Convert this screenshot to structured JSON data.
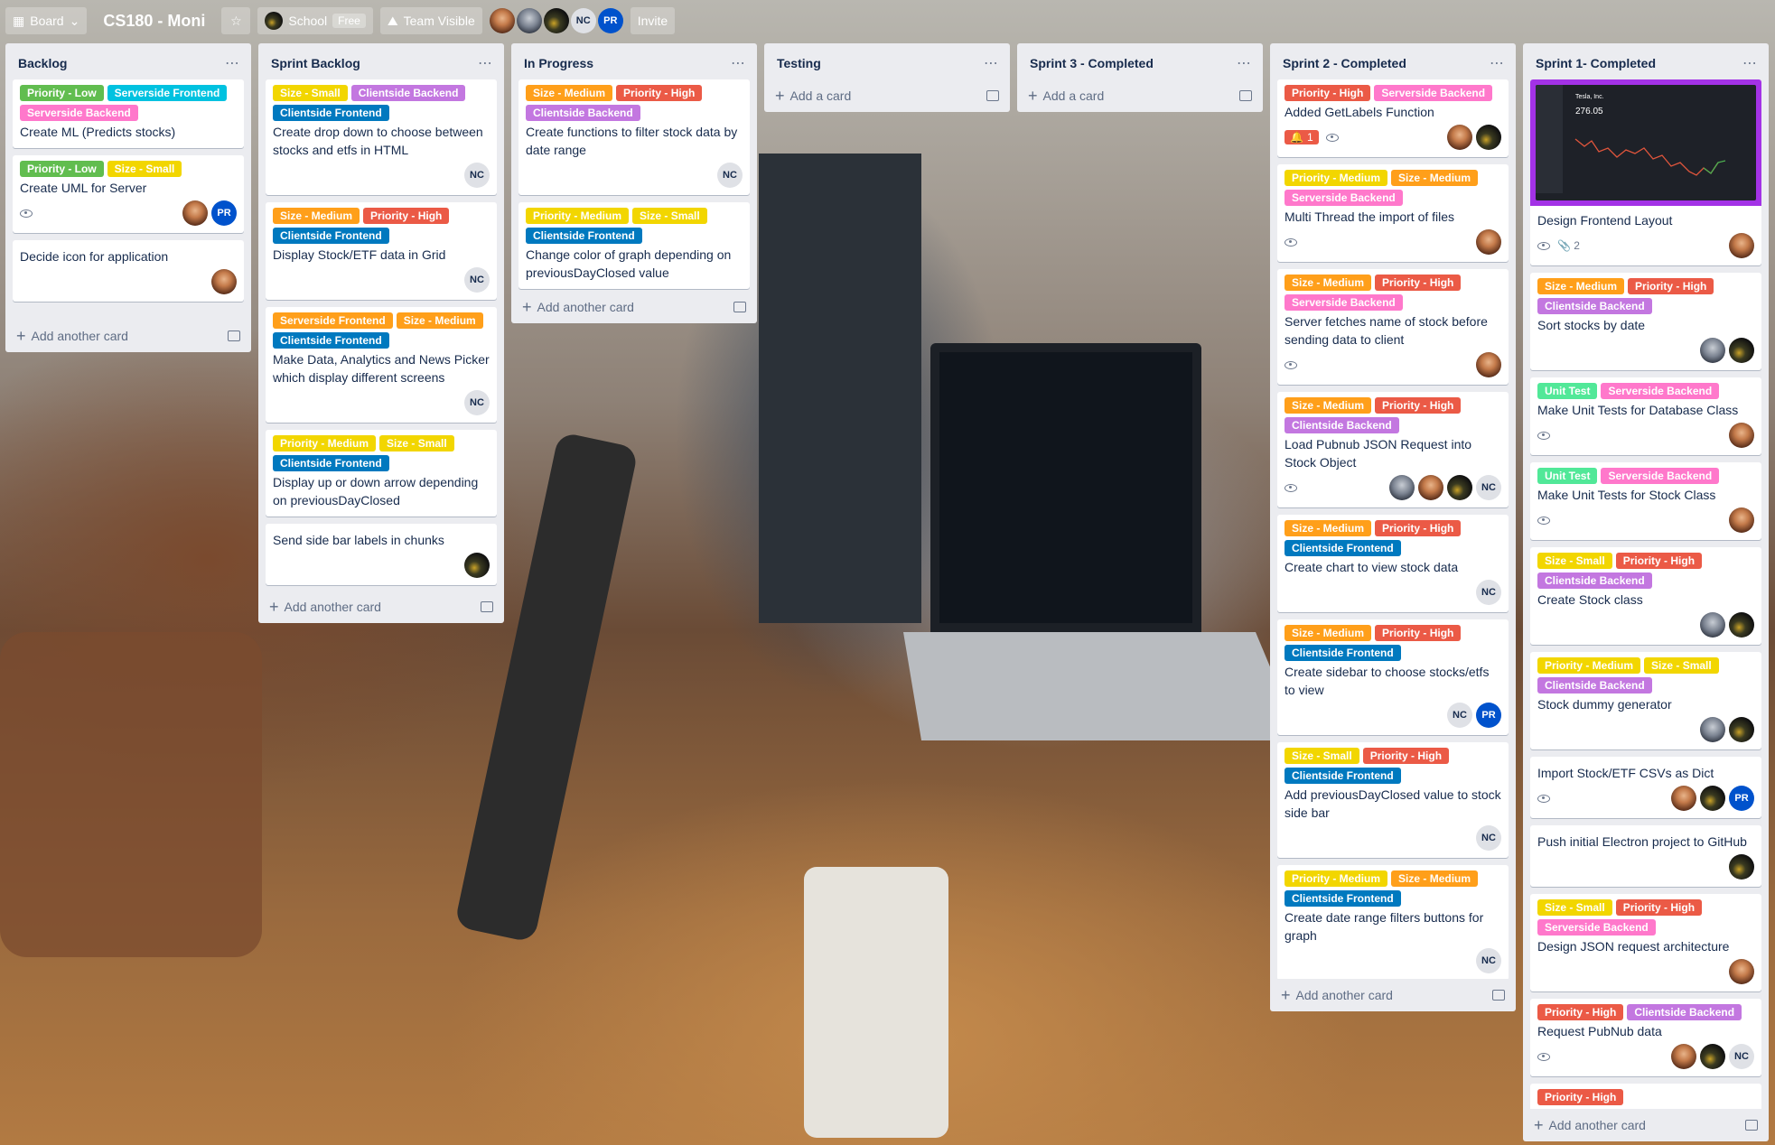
{
  "header": {
    "board_switch": "Board",
    "title": "CS180 - Moni",
    "team_name": "School",
    "team_plan": "Free",
    "visibility": "Team Visible",
    "members": [
      "NC",
      "PR"
    ],
    "invite": "Invite"
  },
  "colors": {
    "green": "#61bd4f",
    "sky": "#00c2e0",
    "pink": "#ff78cb",
    "yellow": "#f2d600",
    "purple": "#c377e0",
    "blue": "#0079bf",
    "orange": "#ff9f1a",
    "red": "#eb5a46",
    "lime": "#51e898"
  },
  "lists": [
    {
      "title": "Backlog",
      "add": "Add another card",
      "cards": [
        {
          "labels": [
            [
              "Priority - Low",
              "green"
            ],
            [
              "Serverside Frontend",
              "sky"
            ],
            [
              "Serverside Backend",
              "pink"
            ]
          ],
          "title": "Create ML (Predicts stocks)"
        },
        {
          "labels": [
            [
              "Priority - Low",
              "green"
            ],
            [
              "Size - Small",
              "yellow"
            ]
          ],
          "title": "Create UML for Server",
          "watch": true,
          "members": [
            "photo1",
            "PR"
          ]
        },
        {
          "labels": [],
          "title": "Decide icon for application",
          "members": [
            "photo1"
          ]
        }
      ]
    },
    {
      "title": "Sprint Backlog",
      "add": "Add another card",
      "cards": [
        {
          "labels": [
            [
              "Size - Small",
              "yellow"
            ],
            [
              "Clientside Backend",
              "purple"
            ],
            [
              "Clientside Frontend",
              "blue"
            ]
          ],
          "title": "Create drop down to choose between stocks and etfs in HTML",
          "members": [
            "NC"
          ]
        },
        {
          "labels": [
            [
              "Size - Medium",
              "orange"
            ],
            [
              "Priority - High",
              "red"
            ],
            [
              "Clientside Frontend",
              "blue"
            ]
          ],
          "title": "Display Stock/ETF data in Grid",
          "members": [
            "NC"
          ]
        },
        {
          "labels": [
            [
              "Serverside Frontend",
              "orange"
            ],
            [
              "Size - Medium",
              "orange"
            ],
            [
              "Clientside Frontend",
              "blue"
            ]
          ],
          "title": "Make Data, Analytics and News Picker which display different screens",
          "members": [
            "NC"
          ]
        },
        {
          "labels": [
            [
              "Priority - Medium",
              "yellow"
            ],
            [
              "Size - Small",
              "yellow"
            ],
            [
              "Clientside Frontend",
              "blue"
            ]
          ],
          "title": "Display up or down arrow depending on previousDayClosed"
        },
        {
          "labels": [],
          "title": "Send side bar labels in chunks",
          "members": [
            "dark"
          ]
        }
      ]
    },
    {
      "title": "In Progress",
      "add": "Add another card",
      "cards": [
        {
          "labels": [
            [
              "Size - Medium",
              "orange"
            ],
            [
              "Priority - High",
              "red"
            ],
            [
              "Clientside Backend",
              "purple"
            ]
          ],
          "title": "Create functions to filter stock data by date range",
          "members": [
            "NC"
          ]
        },
        {
          "labels": [
            [
              "Priority - Medium",
              "yellow"
            ],
            [
              "Size - Small",
              "yellow"
            ],
            [
              "Clientside Frontend",
              "blue"
            ]
          ],
          "title": "Change color of graph depending on previousDayClosed value"
        }
      ]
    },
    {
      "title": "Testing",
      "add": "Add a card",
      "cards": []
    },
    {
      "title": "Sprint 3 - Completed",
      "add": "Add a card",
      "cards": []
    },
    {
      "title": "Sprint 2 - Completed",
      "add": "Add another card",
      "cards": [
        {
          "labels": [
            [
              "Priority - High",
              "red"
            ],
            [
              "Serverside Backend",
              "pink"
            ]
          ],
          "title": "Added GetLabels Function",
          "alert": "1",
          "watch": true,
          "members": [
            "photo1",
            "dark"
          ]
        },
        {
          "labels": [
            [
              "Priority - Medium",
              "yellow"
            ],
            [
              "Size - Medium",
              "orange"
            ],
            [
              "Serverside Backend",
              "pink"
            ]
          ],
          "title": "Multi Thread the import of files",
          "watch": true,
          "members": [
            "photo1"
          ]
        },
        {
          "labels": [
            [
              "Size - Medium",
              "orange"
            ],
            [
              "Priority - High",
              "red"
            ],
            [
              "Serverside Backend",
              "pink"
            ]
          ],
          "title": "Server fetches name of stock before sending data to client",
          "watch": true,
          "members": [
            "photo1"
          ]
        },
        {
          "labels": [
            [
              "Size - Medium",
              "orange"
            ],
            [
              "Priority - High",
              "red"
            ],
            [
              "Clientside Backend",
              "purple"
            ]
          ],
          "title": "Load Pubnub JSON Request into Stock Object",
          "watch": true,
          "members": [
            "photo2",
            "photo1",
            "dark",
            "NC"
          ]
        },
        {
          "labels": [
            [
              "Size - Medium",
              "orange"
            ],
            [
              "Priority - High",
              "red"
            ],
            [
              "Clientside Frontend",
              "blue"
            ]
          ],
          "title": "Create chart to view stock data",
          "members": [
            "NC"
          ]
        },
        {
          "labels": [
            [
              "Size - Medium",
              "orange"
            ],
            [
              "Priority - High",
              "red"
            ],
            [
              "Clientside Frontend",
              "blue"
            ]
          ],
          "title": "Create sidebar to choose stocks/etfs to view",
          "members": [
            "NC",
            "PR"
          ]
        },
        {
          "labels": [
            [
              "Size - Small",
              "yellow"
            ],
            [
              "Priority - High",
              "red"
            ],
            [
              "Clientside Frontend",
              "blue"
            ]
          ],
          "title": "Add previousDayClosed value to stock side bar",
          "members": [
            "NC"
          ]
        },
        {
          "labels": [
            [
              "Priority - Medium",
              "yellow"
            ],
            [
              "Size - Medium",
              "orange"
            ],
            [
              "Clientside Frontend",
              "blue"
            ]
          ],
          "title": "Create date range filters buttons for graph",
          "members": [
            "NC"
          ]
        }
      ]
    },
    {
      "title": "Sprint 1- Completed",
      "add": "Add another card",
      "cards": [
        {
          "cover": true,
          "cover_title": "Tesla, Inc.",
          "cover_price": "276.05",
          "labels": [],
          "title": "Design Frontend Layout",
          "watch": true,
          "attach": "2",
          "members": [
            "photo1"
          ]
        },
        {
          "labels": [
            [
              "Size - Medium",
              "orange"
            ],
            [
              "Priority - High",
              "red"
            ],
            [
              "Clientside Backend",
              "purple"
            ]
          ],
          "title": "Sort stocks by date",
          "members": [
            "photo2",
            "dark"
          ]
        },
        {
          "labels": [
            [
              "Unit Test",
              "lime"
            ],
            [
              "Serverside Backend",
              "pink"
            ]
          ],
          "title": "Make Unit Tests for Database Class",
          "watch": true,
          "members": [
            "photo1"
          ]
        },
        {
          "labels": [
            [
              "Unit Test",
              "lime"
            ],
            [
              "Serverside Backend",
              "pink"
            ]
          ],
          "title": "Make Unit Tests for Stock Class",
          "watch": true,
          "members": [
            "photo1"
          ]
        },
        {
          "labels": [
            [
              "Size - Small",
              "yellow"
            ],
            [
              "Priority - High",
              "red"
            ],
            [
              "Clientside Backend",
              "purple"
            ]
          ],
          "title": "Create Stock class",
          "members": [
            "photo2",
            "dark"
          ]
        },
        {
          "labels": [
            [
              "Priority - Medium",
              "yellow"
            ],
            [
              "Size - Small",
              "yellow"
            ],
            [
              "Clientside Backend",
              "purple"
            ]
          ],
          "title": "Stock dummy generator",
          "members": [
            "photo2",
            "dark"
          ]
        },
        {
          "labels": [],
          "title": "Import Stock/ETF CSVs as Dict",
          "watch": true,
          "members": [
            "photo1",
            "dark",
            "PR"
          ]
        },
        {
          "labels": [],
          "title": "Push initial Electron project to GitHub",
          "members": [
            "dark"
          ]
        },
        {
          "labels": [
            [
              "Size - Small",
              "yellow"
            ],
            [
              "Priority - High",
              "red"
            ],
            [
              "Serverside Backend",
              "pink"
            ]
          ],
          "title": "Design JSON request architecture",
          "members": [
            "photo1"
          ]
        },
        {
          "labels": [
            [
              "Priority - High",
              "red"
            ],
            [
              "Clientside Backend",
              "purple"
            ]
          ],
          "title": "Request PubNub data",
          "watch": true,
          "members": [
            "photo1",
            "dark",
            "NC"
          ]
        },
        {
          "labels": [
            [
              "Priority - High",
              "red"
            ]
          ],
          "title": ""
        }
      ]
    }
  ]
}
